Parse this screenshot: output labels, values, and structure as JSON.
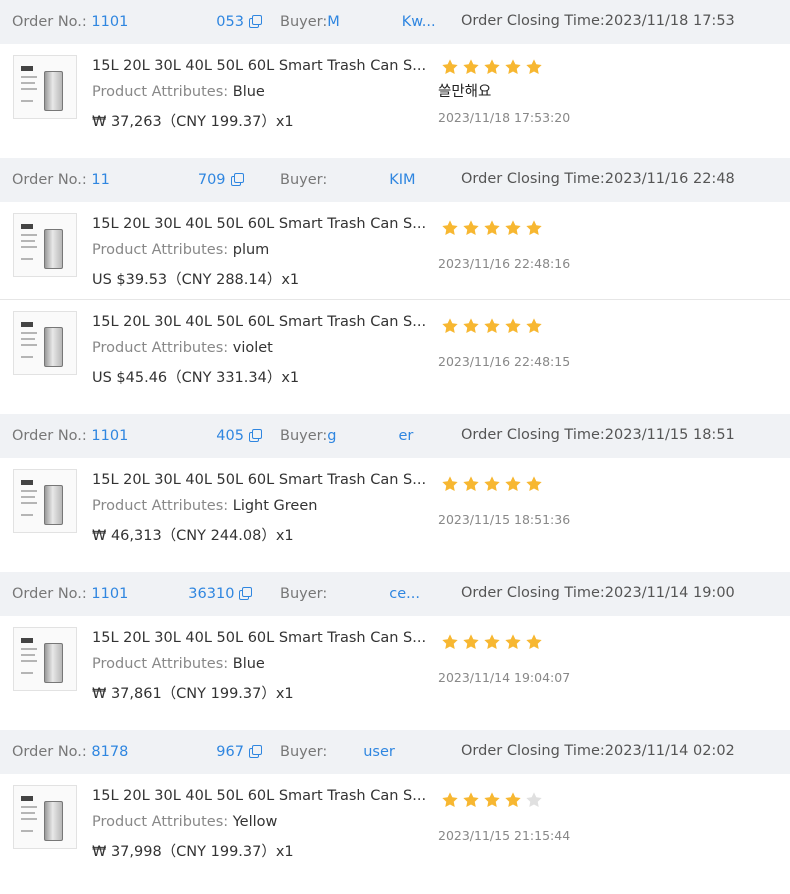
{
  "labels": {
    "order_no": "Order No.:",
    "buyer": "Buyer:",
    "closing": "Order Closing Time:",
    "attributes": "Product Attributes:"
  },
  "colors": {
    "link": "#2f86e0",
    "header_bg": "#f0f2f5",
    "star_on": "#f7b731",
    "star_off": "#e0e0e0"
  },
  "orders": [
    {
      "order_no_start": "1101",
      "order_no_end": "053",
      "buyer_start": "M",
      "buyer_end": "Kw...",
      "closing_time": "2023/11/18 17:53",
      "items": [
        {
          "title": "15L 20L 30L 40L 50L 60L Smart Trash Can S...",
          "attribute": "Blue",
          "price": "₩ 37,263（CNY  199.37）x1",
          "rating": 5,
          "comment": "쓸만해요",
          "review_time": "2023/11/18 17:53:20"
        }
      ]
    },
    {
      "order_no_start": "11",
      "order_no_end": "709",
      "buyer_start": "",
      "buyer_end": "KIM",
      "closing_time": "2023/11/16 22:48",
      "items": [
        {
          "title": "15L 20L 30L 40L 50L 60L Smart Trash Can S...",
          "attribute": "plum",
          "price": "US $39.53（CNY  288.14）x1",
          "rating": 5,
          "comment": "",
          "review_time": "2023/11/16 22:48:16"
        },
        {
          "title": "15L 20L 30L 40L 50L 60L Smart Trash Can S...",
          "attribute": "violet",
          "price": "US $45.46（CNY  331.34）x1",
          "rating": 5,
          "comment": "",
          "review_time": "2023/11/16 22:48:15"
        }
      ]
    },
    {
      "order_no_start": "1101",
      "order_no_end": "405",
      "buyer_start": "g",
      "buyer_end": "er",
      "closing_time": "2023/11/15 18:51",
      "items": [
        {
          "title": "15L 20L 30L 40L 50L 60L Smart Trash Can S...",
          "attribute": "Light Green",
          "price": "₩ 46,313（CNY  244.08）x1",
          "rating": 5,
          "comment": "",
          "review_time": "2023/11/15 18:51:36"
        }
      ]
    },
    {
      "order_no_start": "1101",
      "order_no_end": "36310",
      "buyer_start": "",
      "buyer_end": "ce...",
      "closing_time": "2023/11/14 19:00",
      "items": [
        {
          "title": "15L 20L 30L 40L 50L 60L Smart Trash Can S...",
          "attribute": "Blue",
          "price": "₩ 37,861（CNY  199.37）x1",
          "rating": 5,
          "comment": "",
          "review_time": "2023/11/14 19:04:07"
        }
      ]
    },
    {
      "order_no_start": "8178",
      "order_no_end": "967",
      "buyer_start": "",
      "buyer_end": "user",
      "closing_time": "2023/11/14 02:02",
      "items": [
        {
          "title": "15L 20L 30L 40L 50L 60L Smart Trash Can S...",
          "attribute": "Yellow",
          "price": "₩ 37,998（CNY  199.37）x1",
          "rating": 4,
          "comment": "",
          "review_time": "2023/11/15 21:15:44"
        }
      ]
    }
  ]
}
